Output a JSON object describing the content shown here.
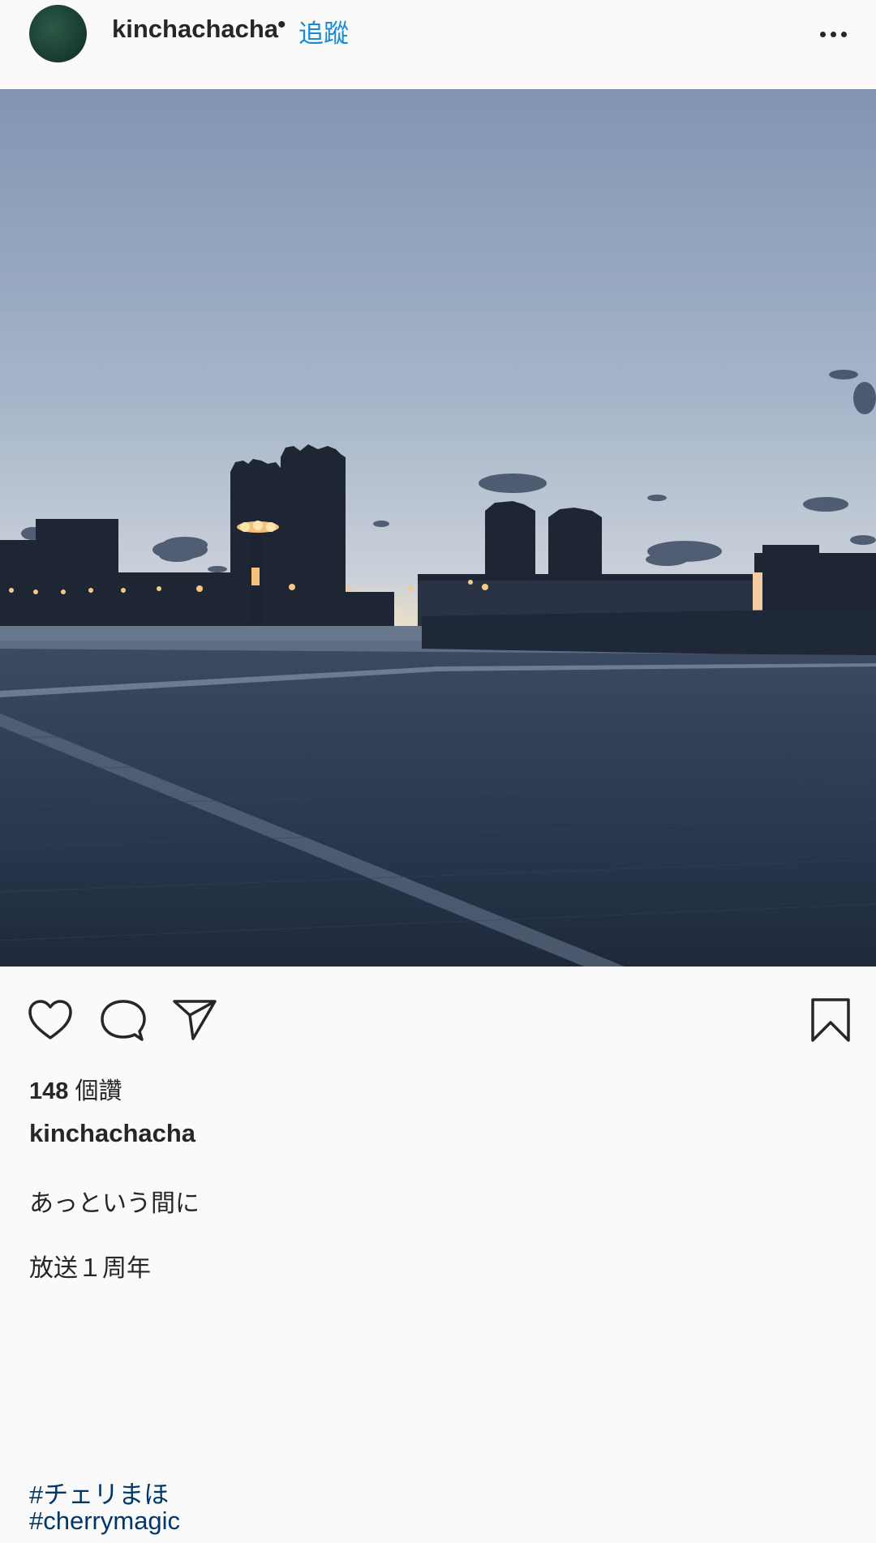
{
  "post": {
    "username": "kinchachacha",
    "separator": "•",
    "follow_label": "追蹤",
    "likes_count": "148",
    "likes_suffix": " 個讚",
    "caption_username": "kinchachacha",
    "caption_lines": [
      "あっという間に",
      "放送１周年"
    ],
    "hashtags": [
      "#チェリまほ",
      "#cherrymagic"
    ]
  },
  "icons": {
    "more": "more-options-icon",
    "like": "heart-icon",
    "comment": "comment-icon",
    "share": "send-icon",
    "save": "bookmark-icon"
  },
  "colors": {
    "background": "#fafafa",
    "link": "#1a8ad4",
    "hashtag": "#00376b",
    "text": "#262626"
  }
}
